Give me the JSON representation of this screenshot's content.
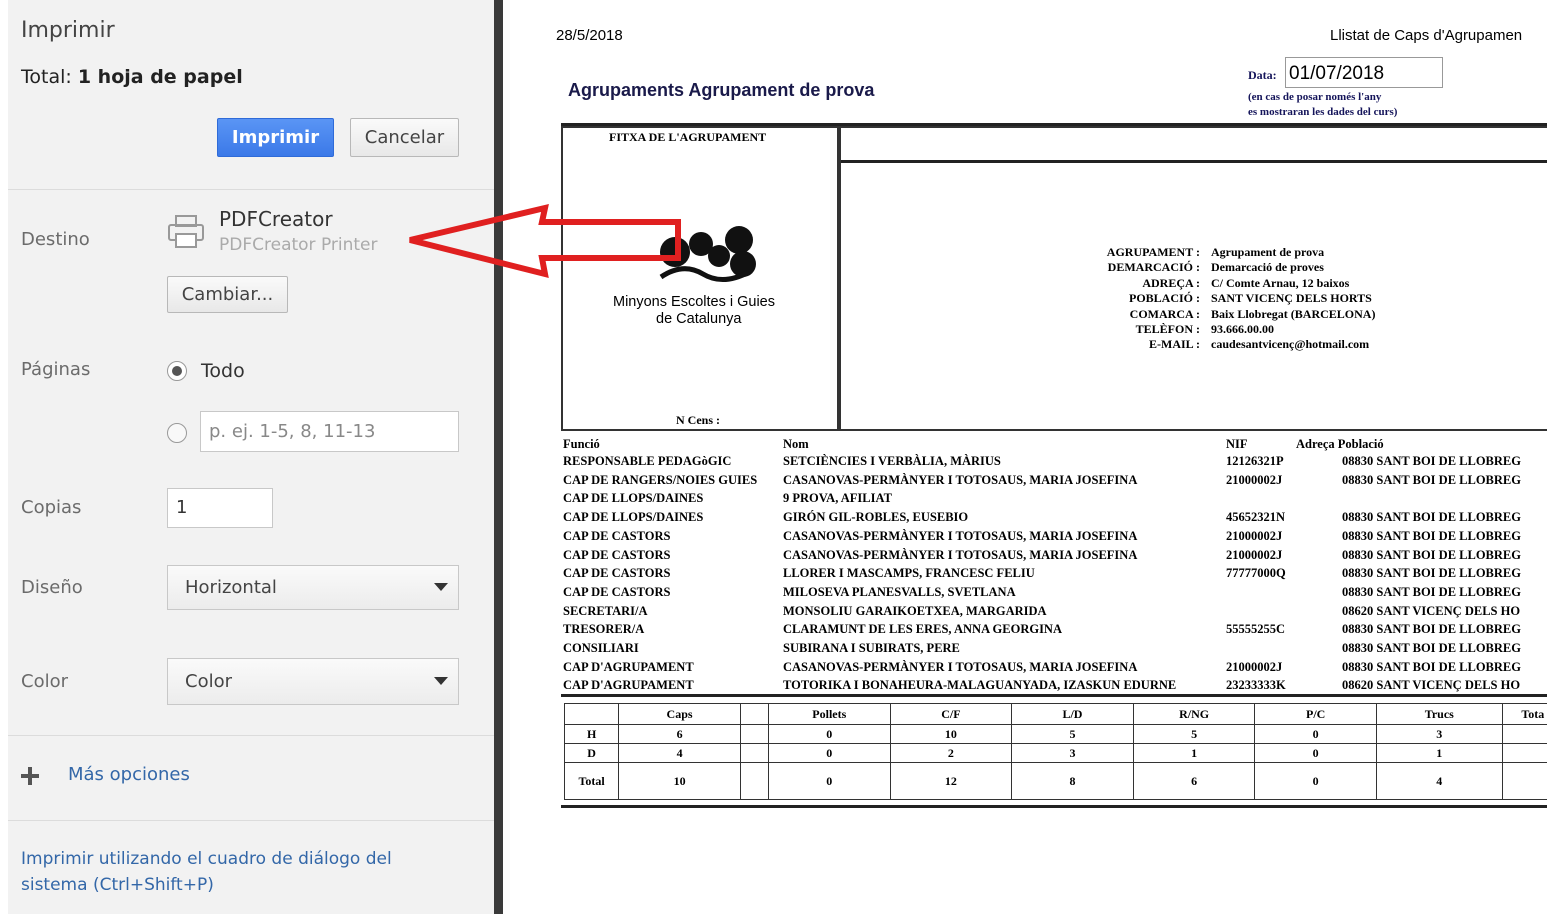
{
  "dialog": {
    "title": "Imprimir",
    "total_prefix": "Total: ",
    "total_value": "1 hoja de papel",
    "print_button": "Imprimir",
    "cancel_button": "Cancelar",
    "destination_label": "Destino",
    "printer_name": "PDFCreator",
    "printer_sub": "PDFCreator Printer",
    "change_button": "Cambiar...",
    "pages_label": "Páginas",
    "pages_all": "Todo",
    "pages_all_selected": true,
    "pages_placeholder": "p. ej. 1-5, 8, 11-13",
    "copies_label": "Copias",
    "copies_value": "1",
    "layout_label": "Diseño",
    "layout_value": "Horizontal",
    "color_label": "Color",
    "color_value": "Color",
    "more_options": "Más opciones",
    "system_dialog_line1": "Imprimir utilizando el cuadro de diálogo del",
    "system_dialog_line2": "sistema (Ctrl+Shift+P)"
  },
  "preview": {
    "date": "28/5/2018",
    "report_title": "Llistat de Caps d'Agrupamen",
    "heading": "Agrupaments Agrupament de prova",
    "data_label": "Data:",
    "data_value": "01/07/2018",
    "data_note_1": "(en cas de posar només l'any",
    "data_note_2": "es mostraran les dades del curs)",
    "fitxa_label": "FITXA DE L'AGRUPAMENT",
    "logo_text_1": "Minyons Escoltes i Guies",
    "logo_text_2": "de Catalunya",
    "n_cens": "N Cens :",
    "info": [
      {
        "k": "AGRUPAMENT :",
        "v": "Agrupament de prova"
      },
      {
        "k": "DEMARCACIÓ :",
        "v": "Demarcació de proves"
      },
      {
        "k": "ADREÇA :",
        "v": "C/ Comte Arnau, 12 baixos"
      },
      {
        "k": "POBLACIÓ :",
        "v": "SANT VICENÇ DELS HORTS"
      },
      {
        "k": "COMARCA :",
        "v": "Baix Llobregat (BARCELONA)"
      },
      {
        "k": "TELÈFON :",
        "v": "93.666.00.00"
      },
      {
        "k": "E-MAIL :",
        "v": "caudesantvicenç@hotmail.com"
      }
    ],
    "columns": {
      "funcio": "Funció",
      "nom": "Nom",
      "nif": "NIF",
      "adreca": "Adreça Població"
    },
    "rows": [
      {
        "funcio": "RESPONSABLE PEDAGòGIC",
        "nom": "SETCIÈNCIES I VERBÀLIA, MÀRIUS",
        "nif": "12126321P",
        "pob": "08830 SANT BOI DE LLOBREG"
      },
      {
        "funcio": "CAP DE RANGERS/NOIES GUIES",
        "nom": "CASANOVAS-PERMÀNYER I TOTOSAUS, MARIA JOSEFINA",
        "nif": "21000002J",
        "pob": "08830 SANT BOI DE LLOBREG"
      },
      {
        "funcio": "CAP DE LLOPS/DAINES",
        "nom": "9 PROVA, AFILIAT",
        "nif": "",
        "pob": ""
      },
      {
        "funcio": "CAP DE LLOPS/DAINES",
        "nom": "GIRÓN GIL-ROBLES, EUSEBIO",
        "nif": "45652321N",
        "pob": "08830 SANT BOI DE LLOBREG"
      },
      {
        "funcio": "CAP DE CASTORS",
        "nom": "CASANOVAS-PERMÀNYER I TOTOSAUS, MARIA JOSEFINA",
        "nif": "21000002J",
        "pob": "08830 SANT BOI DE LLOBREG"
      },
      {
        "funcio": "CAP DE CASTORS",
        "nom": "CASANOVAS-PERMÀNYER I TOTOSAUS, MARIA JOSEFINA",
        "nif": "21000002J",
        "pob": "08830 SANT BOI DE LLOBREG"
      },
      {
        "funcio": "CAP DE CASTORS",
        "nom": "LLORER I MASCAMPS, FRANCESC FELIU",
        "nif": "77777000Q",
        "pob": "08830 SANT BOI DE LLOBREG"
      },
      {
        "funcio": "CAP DE CASTORS",
        "nom": "MILOSEVA PLANESVALLS, SVETLANA",
        "nif": "",
        "pob": "08830 SANT BOI DE LLOBREG"
      },
      {
        "funcio": "SECRETARI/A",
        "nom": "MONSOLIU GARAIKOETXEA, MARGARIDA",
        "nif": "",
        "pob": "08620 SANT VICENÇ DELS HO"
      },
      {
        "funcio": "TRESORER/A",
        "nom": "CLARAMUNT DE LES ERES, ANNA GEORGINA",
        "nif": "55555255C",
        "pob": "08830 SANT BOI DE LLOBREG"
      },
      {
        "funcio": "CONSILIARI",
        "nom": "SUBIRANA I SUBIRATS, PERE",
        "nif": "",
        "pob": "08830 SANT BOI DE LLOBREG"
      },
      {
        "funcio": "CAP D'AGRUPAMENT",
        "nom": "CASANOVAS-PERMÀNYER I TOTOSAUS, MARIA JOSEFINA",
        "nif": "21000002J",
        "pob": "08830 SANT BOI DE LLOBREG"
      },
      {
        "funcio": "CAP D'AGRUPAMENT",
        "nom": "TOTORIKA I BONAHEURA-MALAGUANYADA, IZASKUN EDURNE",
        "nif": "23233333K",
        "pob": "08620 SANT VICENÇ DELS HO"
      }
    ],
    "summary": {
      "headers": [
        "",
        "Caps",
        "",
        "Pollets",
        "C/F",
        "L/D",
        "R/NG",
        "P/C",
        "Trucs",
        "Tota"
      ],
      "rows": [
        [
          "H",
          "6",
          "",
          "0",
          "10",
          "5",
          "5",
          "0",
          "3",
          ""
        ],
        [
          "D",
          "4",
          "",
          "0",
          "2",
          "3",
          "1",
          "0",
          "1",
          ""
        ],
        [
          "Total",
          "10",
          "",
          "0",
          "12",
          "8",
          "6",
          "0",
          "4",
          ""
        ]
      ]
    }
  },
  "colors": {
    "annotation_arrow": "#e02020",
    "print_button": "#4688f1"
  },
  "icons": {
    "printer": "printer-icon",
    "plus": "plus-icon",
    "logo": "msgc-logo"
  }
}
